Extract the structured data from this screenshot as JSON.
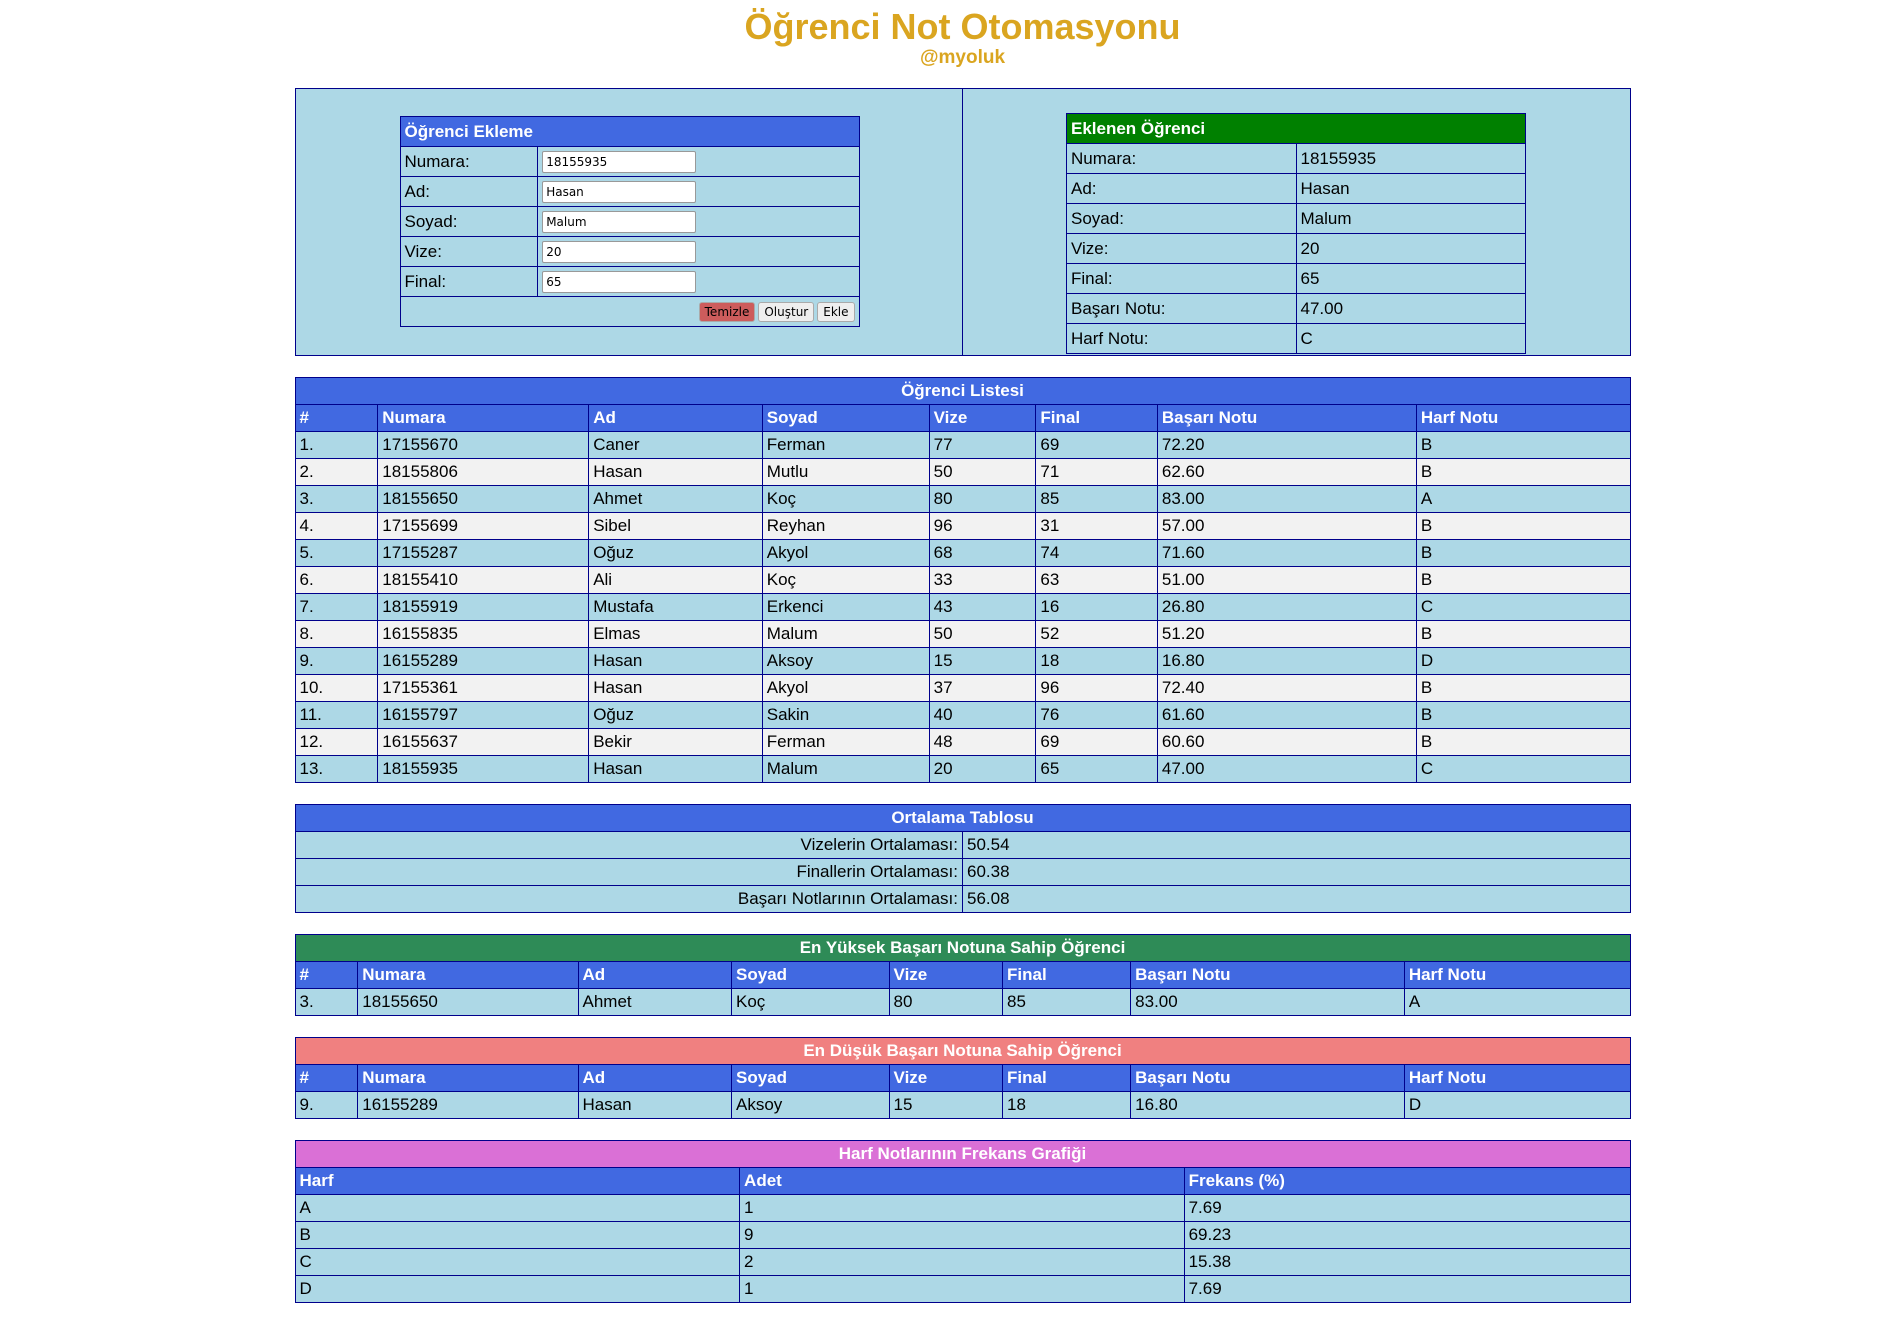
{
  "header": {
    "title": "Öğrenci Not Otomasyonu",
    "subtitle": "@myoluk"
  },
  "form": {
    "title": "Öğrenci Ekleme",
    "fields": [
      {
        "label": "Numara:",
        "value": "18155935"
      },
      {
        "label": "Ad:",
        "value": "Hasan"
      },
      {
        "label": "Soyad:",
        "value": "Malum"
      },
      {
        "label": "Vize:",
        "value": "20"
      },
      {
        "label": "Final:",
        "value": "65"
      }
    ],
    "buttons": {
      "clear": "Temizle",
      "generate": "Oluştur",
      "add": "Ekle"
    }
  },
  "added": {
    "title": "Eklenen Öğrenci",
    "rows": [
      {
        "label": "Numara:",
        "value": "18155935"
      },
      {
        "label": "Ad:",
        "value": "Hasan"
      },
      {
        "label": "Soyad:",
        "value": "Malum"
      },
      {
        "label": "Vize:",
        "value": "20"
      },
      {
        "label": "Final:",
        "value": "65"
      },
      {
        "label": "Başarı Notu:",
        "value": "47.00"
      },
      {
        "label": "Harf Notu:",
        "value": "C"
      }
    ]
  },
  "columns": [
    "#",
    "Numara",
    "Ad",
    "Soyad",
    "Vize",
    "Final",
    "Başarı Notu",
    "Harf Notu"
  ],
  "list": {
    "title": "Öğrenci Listesi",
    "rows": [
      [
        "1.",
        "17155670",
        "Caner",
        "Ferman",
        "77",
        "69",
        "72.20",
        "B"
      ],
      [
        "2.",
        "18155806",
        "Hasan",
        "Mutlu",
        "50",
        "71",
        "62.60",
        "B"
      ],
      [
        "3.",
        "18155650",
        "Ahmet",
        "Koç",
        "80",
        "85",
        "83.00",
        "A"
      ],
      [
        "4.",
        "17155699",
        "Sibel",
        "Reyhan",
        "96",
        "31",
        "57.00",
        "B"
      ],
      [
        "5.",
        "17155287",
        "Oğuz",
        "Akyol",
        "68",
        "74",
        "71.60",
        "B"
      ],
      [
        "6.",
        "18155410",
        "Ali",
        "Koç",
        "33",
        "63",
        "51.00",
        "B"
      ],
      [
        "7.",
        "18155919",
        "Mustafa",
        "Erkenci",
        "43",
        "16",
        "26.80",
        "C"
      ],
      [
        "8.",
        "16155835",
        "Elmas",
        "Malum",
        "50",
        "52",
        "51.20",
        "B"
      ],
      [
        "9.",
        "16155289",
        "Hasan",
        "Aksoy",
        "15",
        "18",
        "16.80",
        "D"
      ],
      [
        "10.",
        "17155361",
        "Hasan",
        "Akyol",
        "37",
        "96",
        "72.40",
        "B"
      ],
      [
        "11.",
        "16155797",
        "Oğuz",
        "Sakin",
        "40",
        "76",
        "61.60",
        "B"
      ],
      [
        "12.",
        "16155637",
        "Bekir",
        "Ferman",
        "48",
        "69",
        "60.60",
        "B"
      ],
      [
        "13.",
        "18155935",
        "Hasan",
        "Malum",
        "20",
        "65",
        "47.00",
        "C"
      ]
    ]
  },
  "averages": {
    "title": "Ortalama Tablosu",
    "rows": [
      {
        "label": "Vizelerin Ortalaması:",
        "value": "50.54"
      },
      {
        "label": "Finallerin Ortalaması:",
        "value": "60.38"
      },
      {
        "label": "Başarı Notlarının Ortalaması:",
        "value": "56.08"
      }
    ]
  },
  "highest": {
    "title": "En Yüksek Başarı Notuna Sahip Öğrenci",
    "row": [
      "3.",
      "18155650",
      "Ahmet",
      "Koç",
      "80",
      "85",
      "83.00",
      "A"
    ]
  },
  "lowest": {
    "title": "En Düşük Başarı Notuna Sahip Öğrenci",
    "row": [
      "9.",
      "16155289",
      "Hasan",
      "Aksoy",
      "15",
      "18",
      "16.80",
      "D"
    ]
  },
  "frequency": {
    "title": "Harf Notlarının Frekans Grafiği",
    "columns": [
      "Harf",
      "Adet",
      "Frekans (%)"
    ],
    "rows": [
      [
        "A",
        "1",
        "7.69"
      ],
      [
        "B",
        "9",
        "69.23"
      ],
      [
        "C",
        "2",
        "15.38"
      ],
      [
        "D",
        "1",
        "7.69"
      ]
    ]
  },
  "colors": {
    "title": "#daa520",
    "header_blue": "#4169e1",
    "cell": "#add8e6",
    "alt": "#f2f2f2",
    "added": "#008000",
    "highest": "#2e8b57",
    "lowest": "#f08080",
    "frequency": "#da70d6",
    "clear_button": "#cd5c5c"
  }
}
